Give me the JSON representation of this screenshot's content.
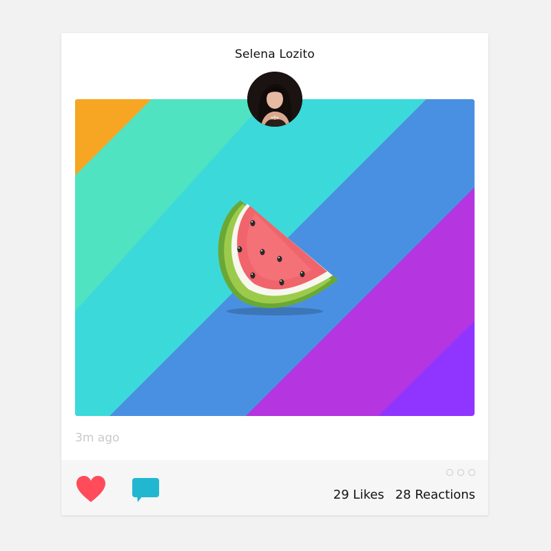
{
  "post": {
    "author_name": "Selena Lozito",
    "timestamp": "3m ago",
    "image_subject": "watermark-slice illustration on diagonal rainbow stripes"
  },
  "actions": {
    "likes_label": "29 Likes",
    "reactions_label": "28 Reactions",
    "like_icon": "heart-icon",
    "comment_icon": "speech-bubble-icon",
    "more_icon": "three-dots-icon"
  },
  "colors": {
    "page_bg": "#f2f2f2",
    "card_bg": "#ffffff",
    "footer_bg": "#f6f6f6",
    "heart": "#ff4b5a",
    "comment": "#21b7d0",
    "stripe_orange": "#f6a623",
    "stripe_mint": "#50e3c2",
    "stripe_cyan": "#3bd9d9",
    "stripe_blue": "#4a90e2",
    "stripe_magenta": "#b535e0",
    "stripe_violet": "#9035ff"
  }
}
